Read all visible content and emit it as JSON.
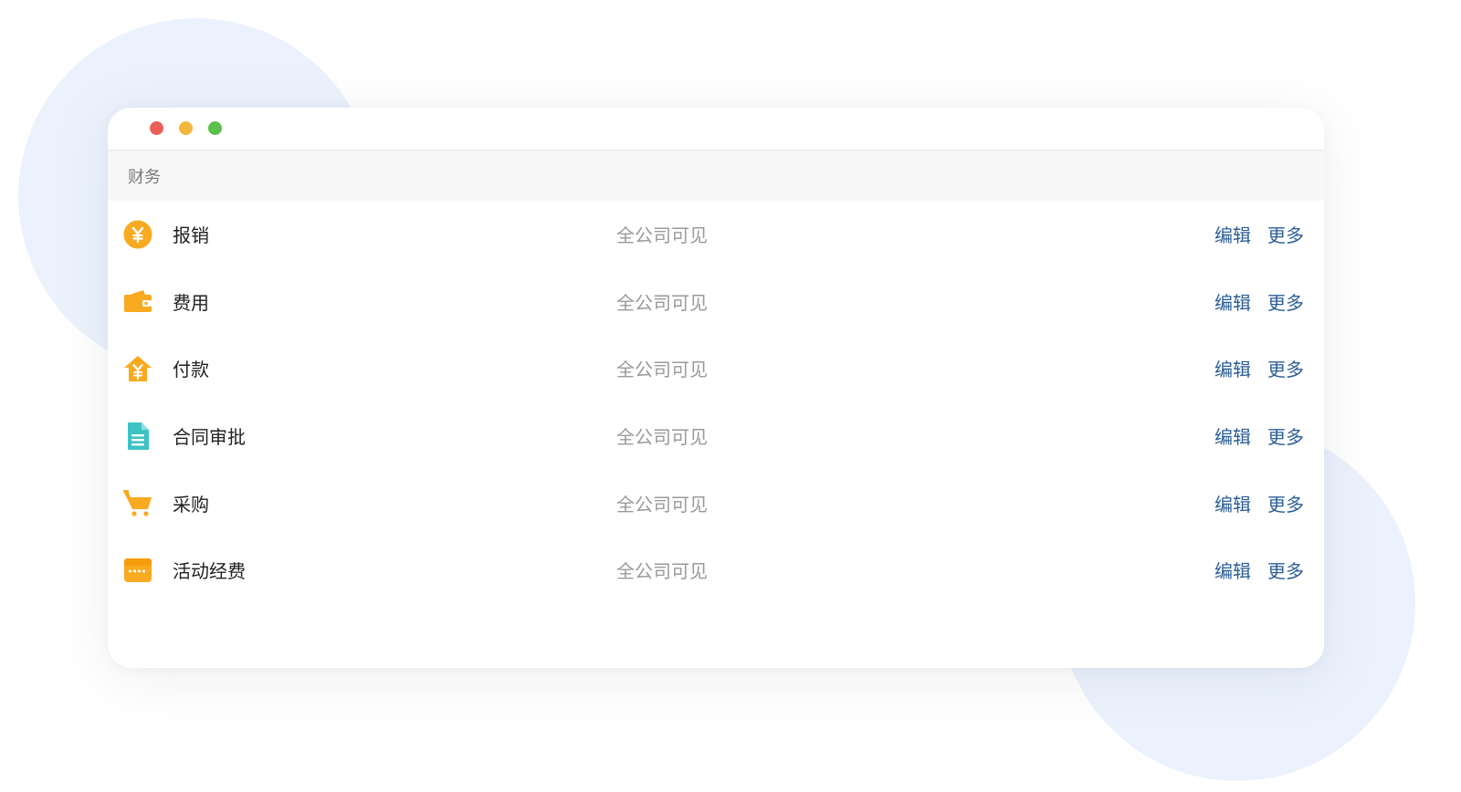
{
  "colors": {
    "accent_orange": "#f8aa20",
    "accent_teal": "#3ec3c5",
    "link_blue": "#2b5e95",
    "traffic_red": "#ec5f59",
    "traffic_yellow": "#f2b73d",
    "traffic_green": "#5bc04c"
  },
  "section": {
    "title": "财务"
  },
  "rows": [
    {
      "icon": "yen-coin-icon",
      "name": "报销",
      "visibility": "全公司可见",
      "edit": "编辑",
      "more": "更多"
    },
    {
      "icon": "wallet-icon",
      "name": "费用",
      "visibility": "全公司可见",
      "edit": "编辑",
      "more": "更多"
    },
    {
      "icon": "house-yen-icon",
      "name": "付款",
      "visibility": "全公司可见",
      "edit": "编辑",
      "more": "更多"
    },
    {
      "icon": "document-icon",
      "name": "合同审批",
      "visibility": "全公司可见",
      "edit": "编辑",
      "more": "更多"
    },
    {
      "icon": "shopping-cart-icon",
      "name": "采购",
      "visibility": "全公司可见",
      "edit": "编辑",
      "more": "更多"
    },
    {
      "icon": "ticket-icon",
      "name": "活动经费",
      "visibility": "全公司可见",
      "edit": "编辑",
      "more": "更多"
    }
  ]
}
